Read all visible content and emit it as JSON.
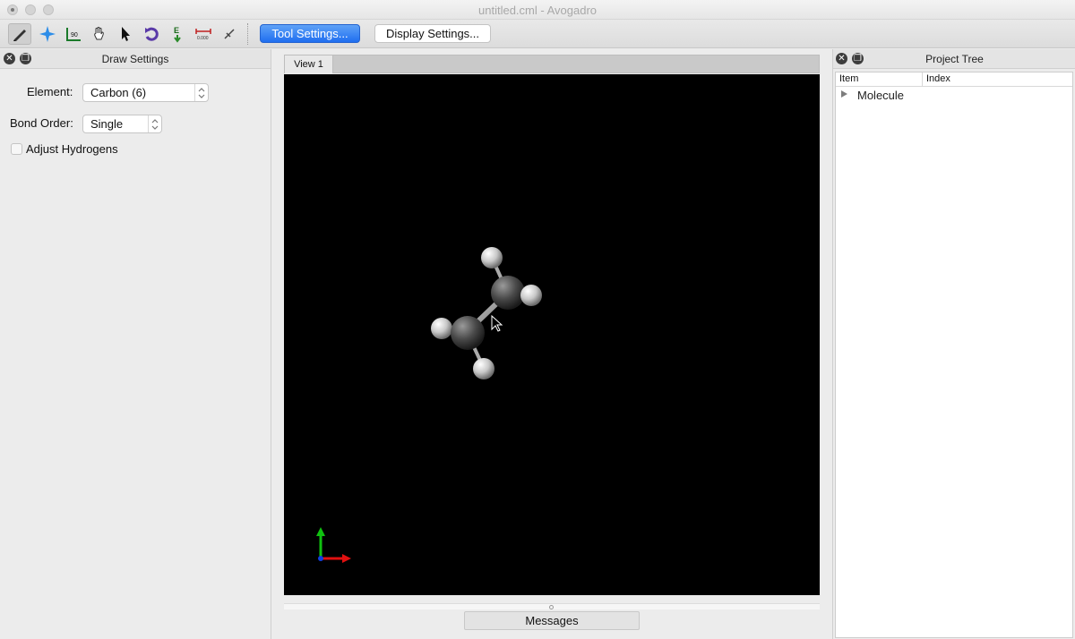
{
  "window": {
    "title": "untitled.cml - Avogadro"
  },
  "toolbar": {
    "tools": [
      {
        "name": "draw-tool-icon",
        "active": true
      },
      {
        "name": "navigate-tool-icon",
        "active": false
      },
      {
        "name": "bond-centric-tool-icon",
        "active": false
      },
      {
        "name": "manipulate-tool-icon",
        "active": false
      },
      {
        "name": "select-tool-icon",
        "active": false
      },
      {
        "name": "auto-rotate-tool-icon",
        "active": false
      },
      {
        "name": "auto-optimize-tool-icon",
        "active": false
      },
      {
        "name": "measure-tool-icon",
        "active": false
      },
      {
        "name": "align-tool-icon",
        "active": false
      }
    ],
    "tool_settings_label": "Tool Settings...",
    "display_settings_label": "Display Settings..."
  },
  "draw_settings": {
    "title": "Draw Settings",
    "element_label": "Element:",
    "element_value": "Carbon (6)",
    "bond_order_label": "Bond Order:",
    "bond_order_value": "Single",
    "adjust_hydrogens_label": "Adjust Hydrogens",
    "adjust_hydrogens_checked": false
  },
  "view": {
    "tab_label": "View 1",
    "background_color": "#000000",
    "atoms": [
      {
        "element": "C"
      },
      {
        "element": "C"
      },
      {
        "element": "H"
      },
      {
        "element": "H"
      },
      {
        "element": "H"
      },
      {
        "element": "H"
      }
    ],
    "axes": {
      "x_color": "#e01010",
      "y_color": "#10c010",
      "z_color": "#1040e0"
    }
  },
  "messages": {
    "label": "Messages"
  },
  "project_tree": {
    "title": "Project Tree",
    "columns": [
      "Item",
      "Index"
    ],
    "rows": [
      {
        "item": "Molecule",
        "index": ""
      }
    ]
  },
  "colors": {
    "accent_button": "#1f6ef0"
  }
}
